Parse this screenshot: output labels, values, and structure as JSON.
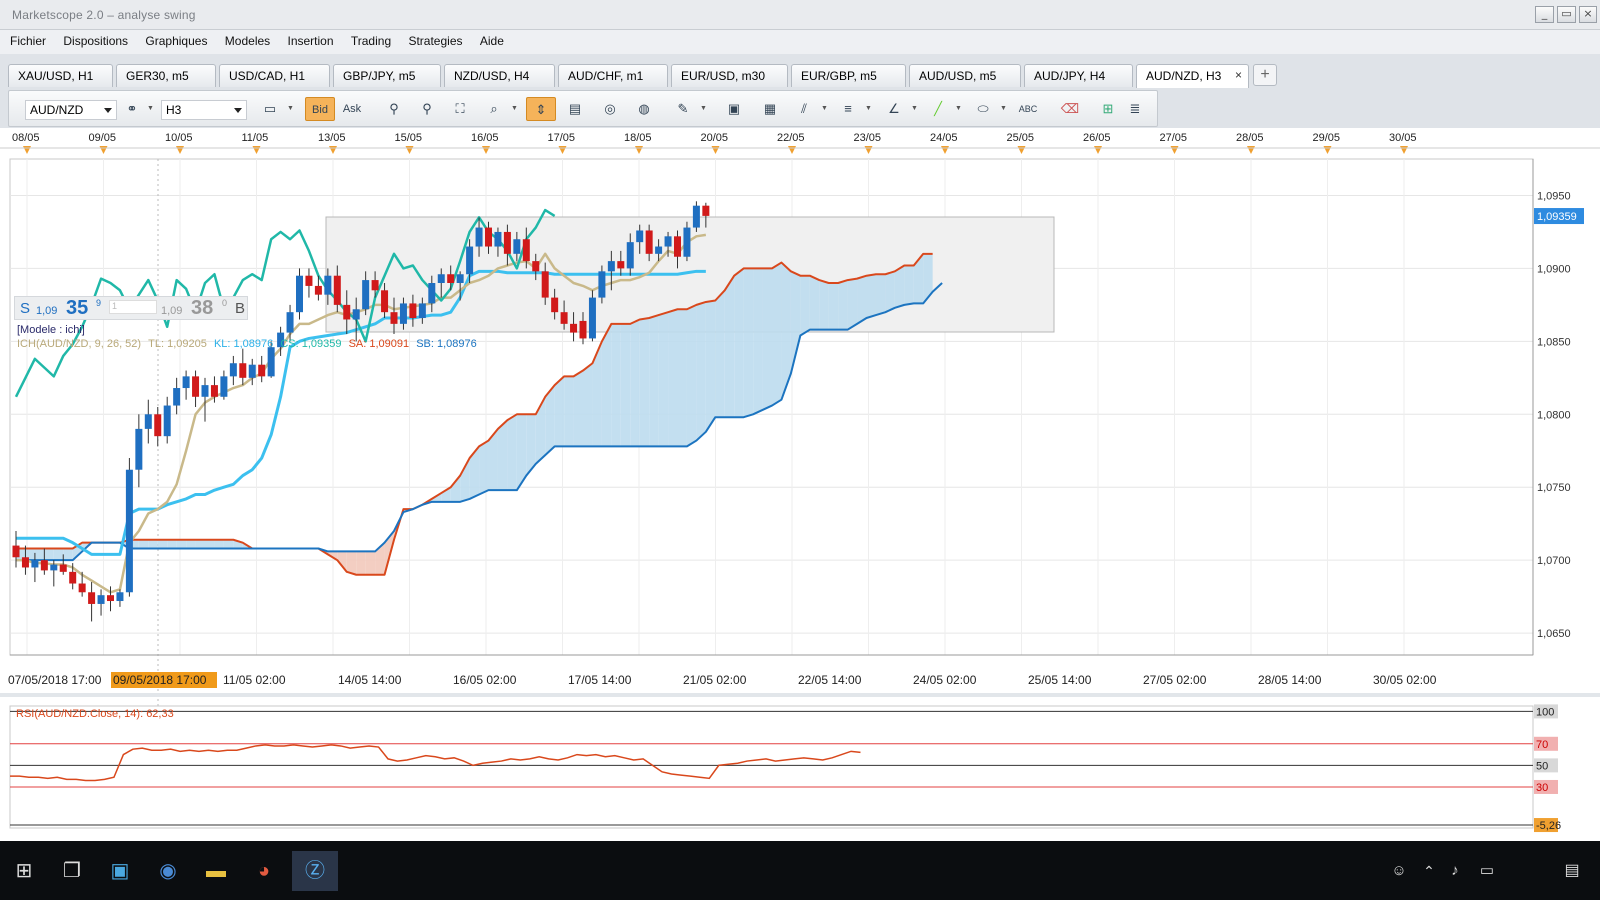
{
  "window": {
    "title": "Marketscope 2.0 – analyse swing",
    "buttons": [
      "_",
      "▭",
      "×"
    ]
  },
  "menu": [
    "Fichier",
    "Dispositions",
    "Graphiques",
    "Modeles",
    "Insertion",
    "Trading",
    "Strategies",
    "Aide"
  ],
  "tabs": [
    {
      "label": "XAU/USD, H1",
      "active": false
    },
    {
      "label": "GER30, m5",
      "active": false
    },
    {
      "label": "USD/CAD, H1",
      "active": false
    },
    {
      "label": "GBP/JPY, m5",
      "active": false
    },
    {
      "label": "NZD/USD, H4",
      "active": false
    },
    {
      "label": "AUD/CHF, m1",
      "active": false
    },
    {
      "label": "EUR/USD, m30",
      "active": false
    },
    {
      "label": "EUR/GBP, m5",
      "active": false
    },
    {
      "label": "AUD/USD, m5",
      "active": false
    },
    {
      "label": "AUD/JPY, H4",
      "active": false
    },
    {
      "label": "AUD/NZD, H3",
      "active": true
    }
  ],
  "tab_close": "×",
  "tab_add": "+",
  "toolbar": {
    "instrument": "AUD/NZD",
    "timeframe": "H3",
    "bid_label": "Bid",
    "ask_label": "Ask",
    "icons": [
      "link-icon",
      "instrument-list-icon",
      "chart-type-icon",
      "bid-button",
      "ask-button",
      "indicator-icon",
      "oscillator-icon",
      "signal-icon",
      "zoom-icon",
      "crosshair-icon",
      "properties-icon",
      "eye-icon",
      "globe-icon",
      "ruler-icon",
      "image-icon",
      "save-chart-icon",
      "lines-icon",
      "hlines-icon",
      "fib-icon",
      "trendline-icon",
      "ellipse-icon",
      "text-icon",
      "eraser-icon",
      "hierarchy-icon",
      "menu-icon"
    ]
  },
  "date_axis_top": [
    "08/05",
    "09/05",
    "10/05",
    "11/05",
    "13/05",
    "15/05",
    "16/05",
    "17/05",
    "18/05",
    "20/05",
    "22/05",
    "23/05",
    "24/05",
    "25/05",
    "26/05",
    "27/05",
    "28/05",
    "29/05",
    "30/05"
  ],
  "quote": {
    "sell_label": "S",
    "sell_big": "1,09",
    "sell_pips": "35",
    "sell_frac": "9",
    "spread": "1",
    "buy_big": "1,09",
    "buy_pips": "38",
    "buy_frac": "0",
    "buy_label": "B"
  },
  "legend": {
    "model": "[Modele : ichi]",
    "ichimoku": "ICH(AUD/NZD, 9, 26, 52)",
    "tl": "TL: 1,09205",
    "kl": "KL: 1,08976",
    "cs": "CS: 1,09359",
    "sa": "SA: 1,09091",
    "sb": "SB: 1,08976"
  },
  "price_axis": {
    "labels": [
      "1,0950",
      "1,0900",
      "1,0850",
      "1,0800",
      "1,0750",
      "1,0700",
      "1,0650"
    ],
    "current": "1,09359"
  },
  "time_axis": [
    "07/05/2018 17:00",
    "09/05/2018 17:00",
    "11/05 02:00",
    "14/05 14:00",
    "16/05 02:00",
    "17/05 14:00",
    "21/05 02:00",
    "22/05 14:00",
    "24/05 02:00",
    "25/05 14:00",
    "27/05 02:00",
    "28/05 14:00",
    "30/05 02:00"
  ],
  "rsi": {
    "label": "RSI(AUD/NZD.Close, 14): 62,33",
    "levels": [
      "100",
      "70",
      "50",
      "30",
      "-5,26"
    ]
  },
  "colors": {
    "bull": "#1f6fc1",
    "bear": "#d11a1a",
    "tenkan": "#c9b98a",
    "kijun": "#3cc0ef",
    "chikou": "#20b8a8",
    "spanA": "#d9481c",
    "spanB": "#1c74c0",
    "cloud": "#bcdcee",
    "rsi": "#d9481c"
  },
  "chart_data": {
    "type": "candlestick",
    "instrument": "AUD/NZD",
    "timeframe": "H3",
    "ylim": [
      1.0635,
      1.0975
    ],
    "current_price": 1.09359,
    "candles": [
      {
        "o": 1.071,
        "h": 1.072,
        "l": 1.0695,
        "c": 1.0702
      },
      {
        "o": 1.0702,
        "h": 1.071,
        "l": 1.069,
        "c": 1.0695
      },
      {
        "o": 1.0695,
        "h": 1.0705,
        "l": 1.0685,
        "c": 1.07
      },
      {
        "o": 1.07,
        "h": 1.0708,
        "l": 1.069,
        "c": 1.0693
      },
      {
        "o": 1.0693,
        "h": 1.07,
        "l": 1.0682,
        "c": 1.0697
      },
      {
        "o": 1.0697,
        "h": 1.0704,
        "l": 1.069,
        "c": 1.0692
      },
      {
        "o": 1.0692,
        "h": 1.0698,
        "l": 1.068,
        "c": 1.0684
      },
      {
        "o": 1.0684,
        "h": 1.0692,
        "l": 1.0675,
        "c": 1.0678
      },
      {
        "o": 1.0678,
        "h": 1.0685,
        "l": 1.0658,
        "c": 1.067
      },
      {
        "o": 1.067,
        "h": 1.068,
        "l": 1.0662,
        "c": 1.0676
      },
      {
        "o": 1.0676,
        "h": 1.0682,
        "l": 1.0665,
        "c": 1.0672
      },
      {
        "o": 1.0672,
        "h": 1.068,
        "l": 1.0668,
        "c": 1.0678
      },
      {
        "o": 1.0678,
        "h": 1.077,
        "l": 1.0675,
        "c": 1.0762
      },
      {
        "o": 1.0762,
        "h": 1.08,
        "l": 1.075,
        "c": 1.079
      },
      {
        "o": 1.079,
        "h": 1.081,
        "l": 1.078,
        "c": 1.08
      },
      {
        "o": 1.08,
        "h": 1.0805,
        "l": 1.0778,
        "c": 1.0785
      },
      {
        "o": 1.0785,
        "h": 1.0812,
        "l": 1.078,
        "c": 1.0806
      },
      {
        "o": 1.0806,
        "h": 1.0825,
        "l": 1.08,
        "c": 1.0818
      },
      {
        "o": 1.0818,
        "h": 1.083,
        "l": 1.081,
        "c": 1.0826
      },
      {
        "o": 1.0826,
        "h": 1.083,
        "l": 1.0805,
        "c": 1.0812
      },
      {
        "o": 1.0812,
        "h": 1.0825,
        "l": 1.0795,
        "c": 1.082
      },
      {
        "o": 1.082,
        "h": 1.0826,
        "l": 1.0808,
        "c": 1.0812
      },
      {
        "o": 1.0812,
        "h": 1.083,
        "l": 1.081,
        "c": 1.0826
      },
      {
        "o": 1.0826,
        "h": 1.084,
        "l": 1.082,
        "c": 1.0835
      },
      {
        "o": 1.0835,
        "h": 1.0845,
        "l": 1.082,
        "c": 1.0825
      },
      {
        "o": 1.0825,
        "h": 1.0838,
        "l": 1.082,
        "c": 1.0834
      },
      {
        "o": 1.0834,
        "h": 1.084,
        "l": 1.0822,
        "c": 1.0826
      },
      {
        "o": 1.0826,
        "h": 1.085,
        "l": 1.0825,
        "c": 1.0846
      },
      {
        "o": 1.0846,
        "h": 1.086,
        "l": 1.084,
        "c": 1.0856
      },
      {
        "o": 1.0856,
        "h": 1.0875,
        "l": 1.085,
        "c": 1.087
      },
      {
        "o": 1.087,
        "h": 1.09,
        "l": 1.0865,
        "c": 1.0895
      },
      {
        "o": 1.0895,
        "h": 1.09,
        "l": 1.088,
        "c": 1.0888
      },
      {
        "o": 1.0888,
        "h": 1.0895,
        "l": 1.0878,
        "c": 1.0882
      },
      {
        "o": 1.0882,
        "h": 1.09,
        "l": 1.0875,
        "c": 1.0895
      },
      {
        "o": 1.0895,
        "h": 1.0902,
        "l": 1.087,
        "c": 1.0875
      },
      {
        "o": 1.0875,
        "h": 1.0885,
        "l": 1.0855,
        "c": 1.0865
      },
      {
        "o": 1.0865,
        "h": 1.088,
        "l": 1.085,
        "c": 1.0872
      },
      {
        "o": 1.0872,
        "h": 1.0898,
        "l": 1.0868,
        "c": 1.0892
      },
      {
        "o": 1.0892,
        "h": 1.0898,
        "l": 1.088,
        "c": 1.0885
      },
      {
        "o": 1.0885,
        "h": 1.089,
        "l": 1.0866,
        "c": 1.087
      },
      {
        "o": 1.087,
        "h": 1.088,
        "l": 1.0855,
        "c": 1.0862
      },
      {
        "o": 1.0862,
        "h": 1.088,
        "l": 1.0858,
        "c": 1.0876
      },
      {
        "o": 1.0876,
        "h": 1.0882,
        "l": 1.086,
        "c": 1.0866
      },
      {
        "o": 1.0866,
        "h": 1.088,
        "l": 1.0862,
        "c": 1.0876
      },
      {
        "o": 1.0876,
        "h": 1.0895,
        "l": 1.087,
        "c": 1.089
      },
      {
        "o": 1.089,
        "h": 1.09,
        "l": 1.088,
        "c": 1.0896
      },
      {
        "o": 1.0896,
        "h": 1.0902,
        "l": 1.0885,
        "c": 1.089
      },
      {
        "o": 1.089,
        "h": 1.0898,
        "l": 1.0878,
        "c": 1.0896
      },
      {
        "o": 1.0896,
        "h": 1.092,
        "l": 1.089,
        "c": 1.0915
      },
      {
        "o": 1.0915,
        "h": 1.0935,
        "l": 1.0908,
        "c": 1.0928
      },
      {
        "o": 1.0928,
        "h": 1.0932,
        "l": 1.091,
        "c": 1.0915
      },
      {
        "o": 1.0915,
        "h": 1.0928,
        "l": 1.0908,
        "c": 1.0925
      },
      {
        "o": 1.0925,
        "h": 1.093,
        "l": 1.0902,
        "c": 1.091
      },
      {
        "o": 1.091,
        "h": 1.0925,
        "l": 1.0905,
        "c": 1.092
      },
      {
        "o": 1.092,
        "h": 1.0928,
        "l": 1.09,
        "c": 1.0905
      },
      {
        "o": 1.0905,
        "h": 1.091,
        "l": 1.0892,
        "c": 1.0898
      },
      {
        "o": 1.0898,
        "h": 1.0904,
        "l": 1.0875,
        "c": 1.088
      },
      {
        "o": 1.088,
        "h": 1.0886,
        "l": 1.0865,
        "c": 1.087
      },
      {
        "o": 1.087,
        "h": 1.0878,
        "l": 1.0858,
        "c": 1.0862
      },
      {
        "o": 1.0862,
        "h": 1.087,
        "l": 1.085,
        "c": 1.0856
      },
      {
        "o": 1.0864,
        "h": 1.087,
        "l": 1.0848,
        "c": 1.0852
      },
      {
        "o": 1.0852,
        "h": 1.0885,
        "l": 1.085,
        "c": 1.088
      },
      {
        "o": 1.088,
        "h": 1.0902,
        "l": 1.0876,
        "c": 1.0898
      },
      {
        "o": 1.0898,
        "h": 1.0912,
        "l": 1.0885,
        "c": 1.0905
      },
      {
        "o": 1.0905,
        "h": 1.0912,
        "l": 1.0895,
        "c": 1.09
      },
      {
        "o": 1.09,
        "h": 1.0924,
        "l": 1.0895,
        "c": 1.0918
      },
      {
        "o": 1.0918,
        "h": 1.093,
        "l": 1.091,
        "c": 1.0926
      },
      {
        "o": 1.0926,
        "h": 1.093,
        "l": 1.0905,
        "c": 1.091
      },
      {
        "o": 1.091,
        "h": 1.092,
        "l": 1.0905,
        "c": 1.0915
      },
      {
        "o": 1.0915,
        "h": 1.0925,
        "l": 1.0908,
        "c": 1.0922
      },
      {
        "o": 1.0922,
        "h": 1.0926,
        "l": 1.09,
        "c": 1.0908
      },
      {
        "o": 1.0908,
        "h": 1.0932,
        "l": 1.0905,
        "c": 1.0928
      },
      {
        "o": 1.0928,
        "h": 1.0946,
        "l": 1.0925,
        "c": 1.0943
      },
      {
        "o": 1.0943,
        "h": 1.0945,
        "l": 1.0928,
        "c": 1.0936
      }
    ],
    "tenkan": [
      1.07,
      1.07,
      1.0698,
      1.0698,
      1.0697,
      1.0697,
      1.0695,
      1.069,
      1.0686,
      1.0682,
      1.0678,
      1.068,
      1.0712,
      1.072,
      1.0732,
      1.0735,
      1.074,
      1.0752,
      1.0775,
      1.08,
      1.0808,
      1.0812,
      1.0815,
      1.0818,
      1.082,
      1.0825,
      1.0828,
      1.0838,
      1.0845,
      1.0855,
      1.0862,
      1.0862,
      1.0865,
      1.0868,
      1.087,
      1.0868,
      1.087,
      1.0872,
      1.0875,
      1.0875,
      1.0872,
      1.0873,
      1.0874,
      1.0875,
      1.0876,
      1.088,
      1.088,
      1.0885,
      1.089,
      1.0892,
      1.0895,
      1.09,
      1.0902,
      1.0904,
      1.0905,
      1.09,
      1.091,
      1.09,
      1.0895,
      1.089,
      1.0888,
      1.0885,
      1.0888,
      1.089,
      1.0892,
      1.0892,
      1.0894,
      1.0897,
      1.0905,
      1.0912,
      1.091,
      1.0918,
      1.0922,
      1.0923
    ],
    "kijun": [
      1.0715,
      1.0715,
      1.0715,
      1.0715,
      1.0715,
      1.0715,
      1.0712,
      1.0708,
      1.0704,
      1.0704,
      1.0704,
      1.0704,
      1.0732,
      1.0735,
      1.0735,
      1.0735,
      1.0738,
      1.074,
      1.0742,
      1.0745,
      1.0745,
      1.0748,
      1.075,
      1.0752,
      1.0758,
      1.0762,
      1.077,
      1.0786,
      1.0812,
      1.0846,
      1.085,
      1.0852,
      1.0853,
      1.0854,
      1.0855,
      1.0856,
      1.0858,
      1.086,
      1.0862,
      1.0866,
      1.0866,
      1.0866,
      1.0866,
      1.0867,
      1.0868,
      1.0868,
      1.087,
      1.088,
      1.0895,
      1.0898,
      1.0898,
      1.0898,
      1.0897,
      1.0897,
      1.0897,
      1.0897,
      1.0897,
      1.0896,
      1.0896,
      1.0896,
      1.0896,
      1.0896,
      1.0896,
      1.0896,
      1.0896,
      1.0896,
      1.0896,
      1.0896,
      1.0896,
      1.0896,
      1.0896,
      1.0897,
      1.0898,
      1.0898
    ],
    "chikou": [
      1.0812,
      1.0825,
      1.0838,
      1.0832,
      1.0826,
      1.084,
      1.0848,
      1.086,
      1.0875,
      1.0893,
      1.089,
      1.0885,
      1.0872,
      1.0882,
      1.0892,
      1.0878,
      1.086,
      1.0892,
      1.0886,
      1.087,
      1.089,
      1.0896,
      1.0872,
      1.088,
      1.0892,
      1.0896,
      1.0892,
      1.092,
      1.0925,
      1.092,
      1.0926,
      1.0912,
      1.0895,
      1.0885,
      1.0878,
      1.087,
      1.0865,
      1.085,
      1.088,
      1.0895,
      1.091,
      1.09,
      1.0902,
      1.0892,
      1.0885,
      1.0878,
      1.0886,
      1.0905,
      1.0925,
      1.0935,
      1.0925,
      1.092,
      1.0912,
      1.09,
      1.092,
      1.0928,
      1.094,
      1.0936
    ],
    "span_a": [
      1.0708,
      1.0708,
      1.0708,
      1.0708,
      1.0708,
      1.0708,
      1.0708,
      1.0712,
      1.0712,
      1.0712,
      1.0712,
      1.0712,
      1.0714,
      1.0714,
      1.0714,
      1.0714,
      1.0714,
      1.0714,
      1.0714,
      1.0714,
      1.0714,
      1.0714,
      1.0714,
      1.0714,
      1.0712,
      1.0708,
      1.0708,
      1.0708,
      1.0708,
      1.0708,
      1.0708,
      1.0708,
      1.0708,
      1.0704,
      1.07,
      1.0692,
      1.069,
      1.069,
      1.069,
      1.069,
      1.0714,
      1.0735,
      1.0735,
      1.0738,
      1.0742,
      1.0746,
      1.075,
      1.0758,
      1.077,
      1.0778,
      1.0782,
      1.079,
      1.0796,
      1.08,
      1.08,
      1.08,
      1.0812,
      1.082,
      1.0826,
      1.0826,
      1.083,
      1.0835,
      1.085,
      1.0862,
      1.0862,
      1.0862,
      1.0865,
      1.0866,
      1.0868,
      1.087,
      1.0872,
      1.0872,
      1.0875,
      1.0877,
      1.0878,
      1.0885,
      1.0895,
      1.09,
      1.09,
      1.09,
      1.09,
      1.0904,
      1.0898,
      1.0895,
      1.0895,
      1.0892,
      1.089,
      1.089,
      1.0892,
      1.0893,
      1.0895,
      1.0896,
      1.0896,
      1.0898,
      1.0902,
      1.0902,
      1.091,
      1.091
    ],
    "span_b": [
      1.07,
      1.07,
      1.07,
      1.07,
      1.07,
      1.07,
      1.07,
      1.0706,
      1.0712,
      1.0712,
      1.0712,
      1.0712,
      1.0708,
      1.0708,
      1.0708,
      1.0708,
      1.0708,
      1.0708,
      1.0708,
      1.0708,
      1.0708,
      1.0708,
      1.0708,
      1.0708,
      1.0708,
      1.0708,
      1.0708,
      1.0708,
      1.0708,
      1.0708,
      1.0708,
      1.0708,
      1.0708,
      1.0706,
      1.0706,
      1.0706,
      1.0706,
      1.0706,
      1.0706,
      1.0712,
      1.072,
      1.0733,
      1.0735,
      1.0738,
      1.074,
      1.074,
      1.074,
      1.074,
      1.0742,
      1.0745,
      1.0748,
      1.0748,
      1.0748,
      1.0748,
      1.0758,
      1.0766,
      1.0772,
      1.0778,
      1.0778,
      1.0778,
      1.0778,
      1.0778,
      1.0778,
      1.0778,
      1.0778,
      1.0778,
      1.0778,
      1.0778,
      1.0778,
      1.0778,
      1.0778,
      1.0778,
      1.0782,
      1.0788,
      1.0798,
      1.0798,
      1.0798,
      1.0798,
      1.08,
      1.0803,
      1.0806,
      1.081,
      1.0828,
      1.0854,
      1.0858,
      1.0858,
      1.0858,
      1.0858,
      1.0858,
      1.0862,
      1.0866,
      1.0868,
      1.087,
      1.0873,
      1.0875,
      1.0876,
      1.0876,
      1.0884,
      1.089
    ],
    "rsi": [
      40,
      40,
      39,
      39,
      38,
      39,
      37,
      37,
      36,
      36,
      37,
      39,
      60,
      65,
      66,
      64,
      64,
      65,
      63,
      64,
      63,
      64,
      63,
      64,
      64,
      66,
      68,
      69,
      68,
      68,
      69,
      68,
      67,
      68,
      69,
      68,
      66,
      67,
      68,
      67,
      56,
      54,
      55,
      57,
      59,
      58,
      56,
      57,
      54,
      50,
      52,
      53,
      54,
      56,
      55,
      56,
      58,
      56,
      55,
      57,
      60,
      59,
      60,
      58,
      59,
      57,
      55,
      56,
      50,
      44,
      42,
      41,
      40,
      39,
      38,
      50,
      51,
      52,
      54,
      55,
      56,
      54,
      55,
      56,
      57,
      56,
      55,
      57,
      60,
      63,
      62
    ]
  }
}
